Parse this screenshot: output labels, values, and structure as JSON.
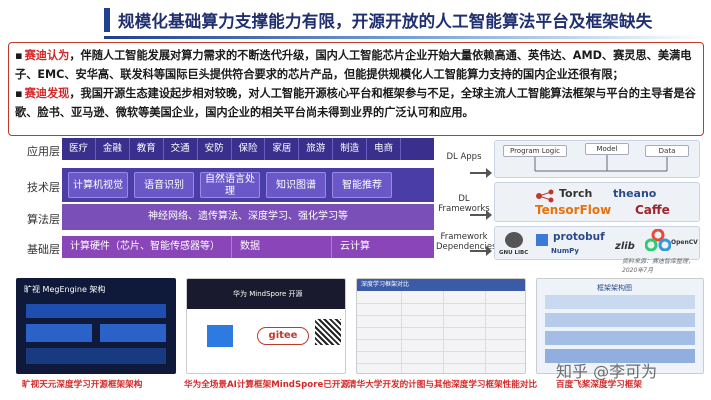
{
  "title": "规模化基础算力支撑能力有限，开源开放的人工智能算法平台及框架缺失",
  "para1": {
    "bullet": "▪",
    "lead": "赛迪认为",
    "text": "，伴随人工智能发展对算力需求的不断迭代升级，国内人工智能芯片企业开始大量依赖高通、英伟达、AMD、赛灵思、美满电子、EMC、安华高、联发科等国际巨头提供符合要求的芯片产品，但能提供规模化人工智能算力支持的国内企业还很有限；"
  },
  "para2": {
    "bullet": "▪",
    "lead": "赛迪发现",
    "text": "，我国开源生态建设起步相对较晚，对人工智能开源核心平台和框架参与不足，全球主流人工智能算法框架与平台的主导者是谷歌、脸书、亚马逊、微软等美国企业，国内企业的相关平台尚未得到业界的广泛认可和应用。"
  },
  "arch": {
    "labels": {
      "app": "应用层",
      "tech": "技术层",
      "algo": "算法层",
      "base": "基础层"
    },
    "apps": [
      "医疗",
      "金融",
      "教育",
      "交通",
      "安防",
      "保险",
      "家居",
      "旅游",
      "制造",
      "电商",
      ""
    ],
    "tech": [
      "计算机视觉",
      "语音识别",
      "自然语言处理",
      "知识图谱",
      "智能推荐"
    ],
    "algo": "神经网络、遗传算法、深度学习、强化学习等",
    "base": [
      "计算硬件（芯片、智能传感器等）",
      "数据",
      "云计算"
    ]
  },
  "frameworks": {
    "labels": {
      "apps": "DL Apps",
      "fw": "DL Frameworks",
      "dep": "Framework Dependencies"
    },
    "app_nodes": [
      "Program Logic",
      "Model",
      "Data"
    ],
    "fw_logos": [
      "Torch",
      "theano",
      "TensorFlow",
      "Caffe"
    ],
    "dep_logos": [
      "protobuf",
      "GNU LIBC",
      "NumPy",
      "OpenCV",
      "zlib"
    ],
    "note": "资料来源：赛迪智库整理，2020年7月"
  },
  "thumbs": {
    "t1_title": "旷视 MegEngine 架构",
    "t2_title": "华为 MindSpore 开源",
    "t2_badge": "gitee",
    "t3_title": "深度学习框架对比",
    "t4_title": "框架架构图"
  },
  "captions": [
    "旷视天元深度学习开源框架架构",
    "华为全场景AI计算框架MindSpore已开源",
    "清华大学开发的计图与其他深度学习框架性能对比",
    "百度飞桨深度学习框架"
  ],
  "watermark": "知乎 @李可为",
  "colors": {
    "accent": "#1f3f8f",
    "red": "#d62828",
    "app_band": "#3a2f8c",
    "tech_band": "#4a3da8",
    "algo_band": "#7a4fb8",
    "base_band": "#8a46b8"
  }
}
